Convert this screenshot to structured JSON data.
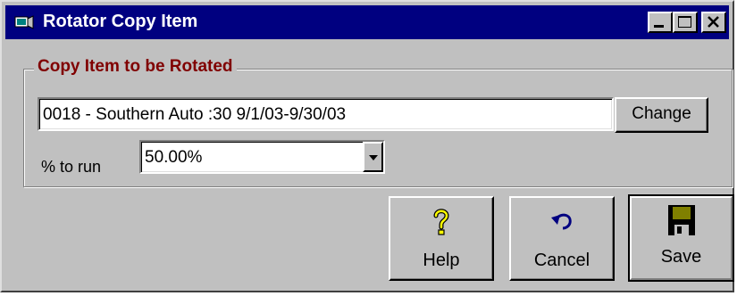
{
  "window": {
    "title": "Rotator Copy Item",
    "controls": [
      "minimize",
      "maximize",
      "close"
    ]
  },
  "group": {
    "label": "Copy Item to be Rotated",
    "label_color": "#800000"
  },
  "copy_item": {
    "value": "0018 - Southern Auto :30 9/1/03-9/30/03",
    "change_label": "Change"
  },
  "percent": {
    "label": "% to run",
    "value": "50.00%"
  },
  "buttons": {
    "help": {
      "label": "Help",
      "icon": "question-mark-icon"
    },
    "cancel": {
      "label": "Cancel",
      "icon": "undo-arrow-icon"
    },
    "save": {
      "label": "Save",
      "icon": "floppy-disk-icon"
    }
  },
  "colors": {
    "titlebar": "#000080",
    "face": "#c0c0c0"
  }
}
